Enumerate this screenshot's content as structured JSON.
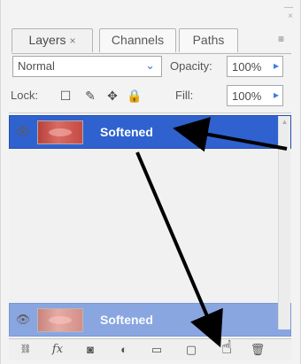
{
  "panel": {
    "tabs": [
      {
        "label": "Layers",
        "close": "×"
      },
      {
        "label": "Channels"
      },
      {
        "label": "Paths"
      }
    ],
    "menu_icon": "panel-menu-icon",
    "window_controls": "minimize-close-icons"
  },
  "controls": {
    "blend_mode": "Normal",
    "opacity_label": "Opacity:",
    "opacity_value": "100%",
    "lock_label": "Lock:",
    "fill_label": "Fill:",
    "fill_value": "100%"
  },
  "layers": {
    "selected": {
      "name": "Softened"
    },
    "ghost": {
      "name": "Softened"
    }
  },
  "footer": {
    "icons": [
      "link-layers-icon",
      "fx-icon",
      "mask-icon",
      "adjustment-layer-icon",
      "folder-icon",
      "new-layer-icon",
      "trash-icon"
    ]
  },
  "colors": {
    "selection_blue": "#2f62cf",
    "ghost_blue": "#8aa6e0",
    "arrow_black": "#000000"
  }
}
